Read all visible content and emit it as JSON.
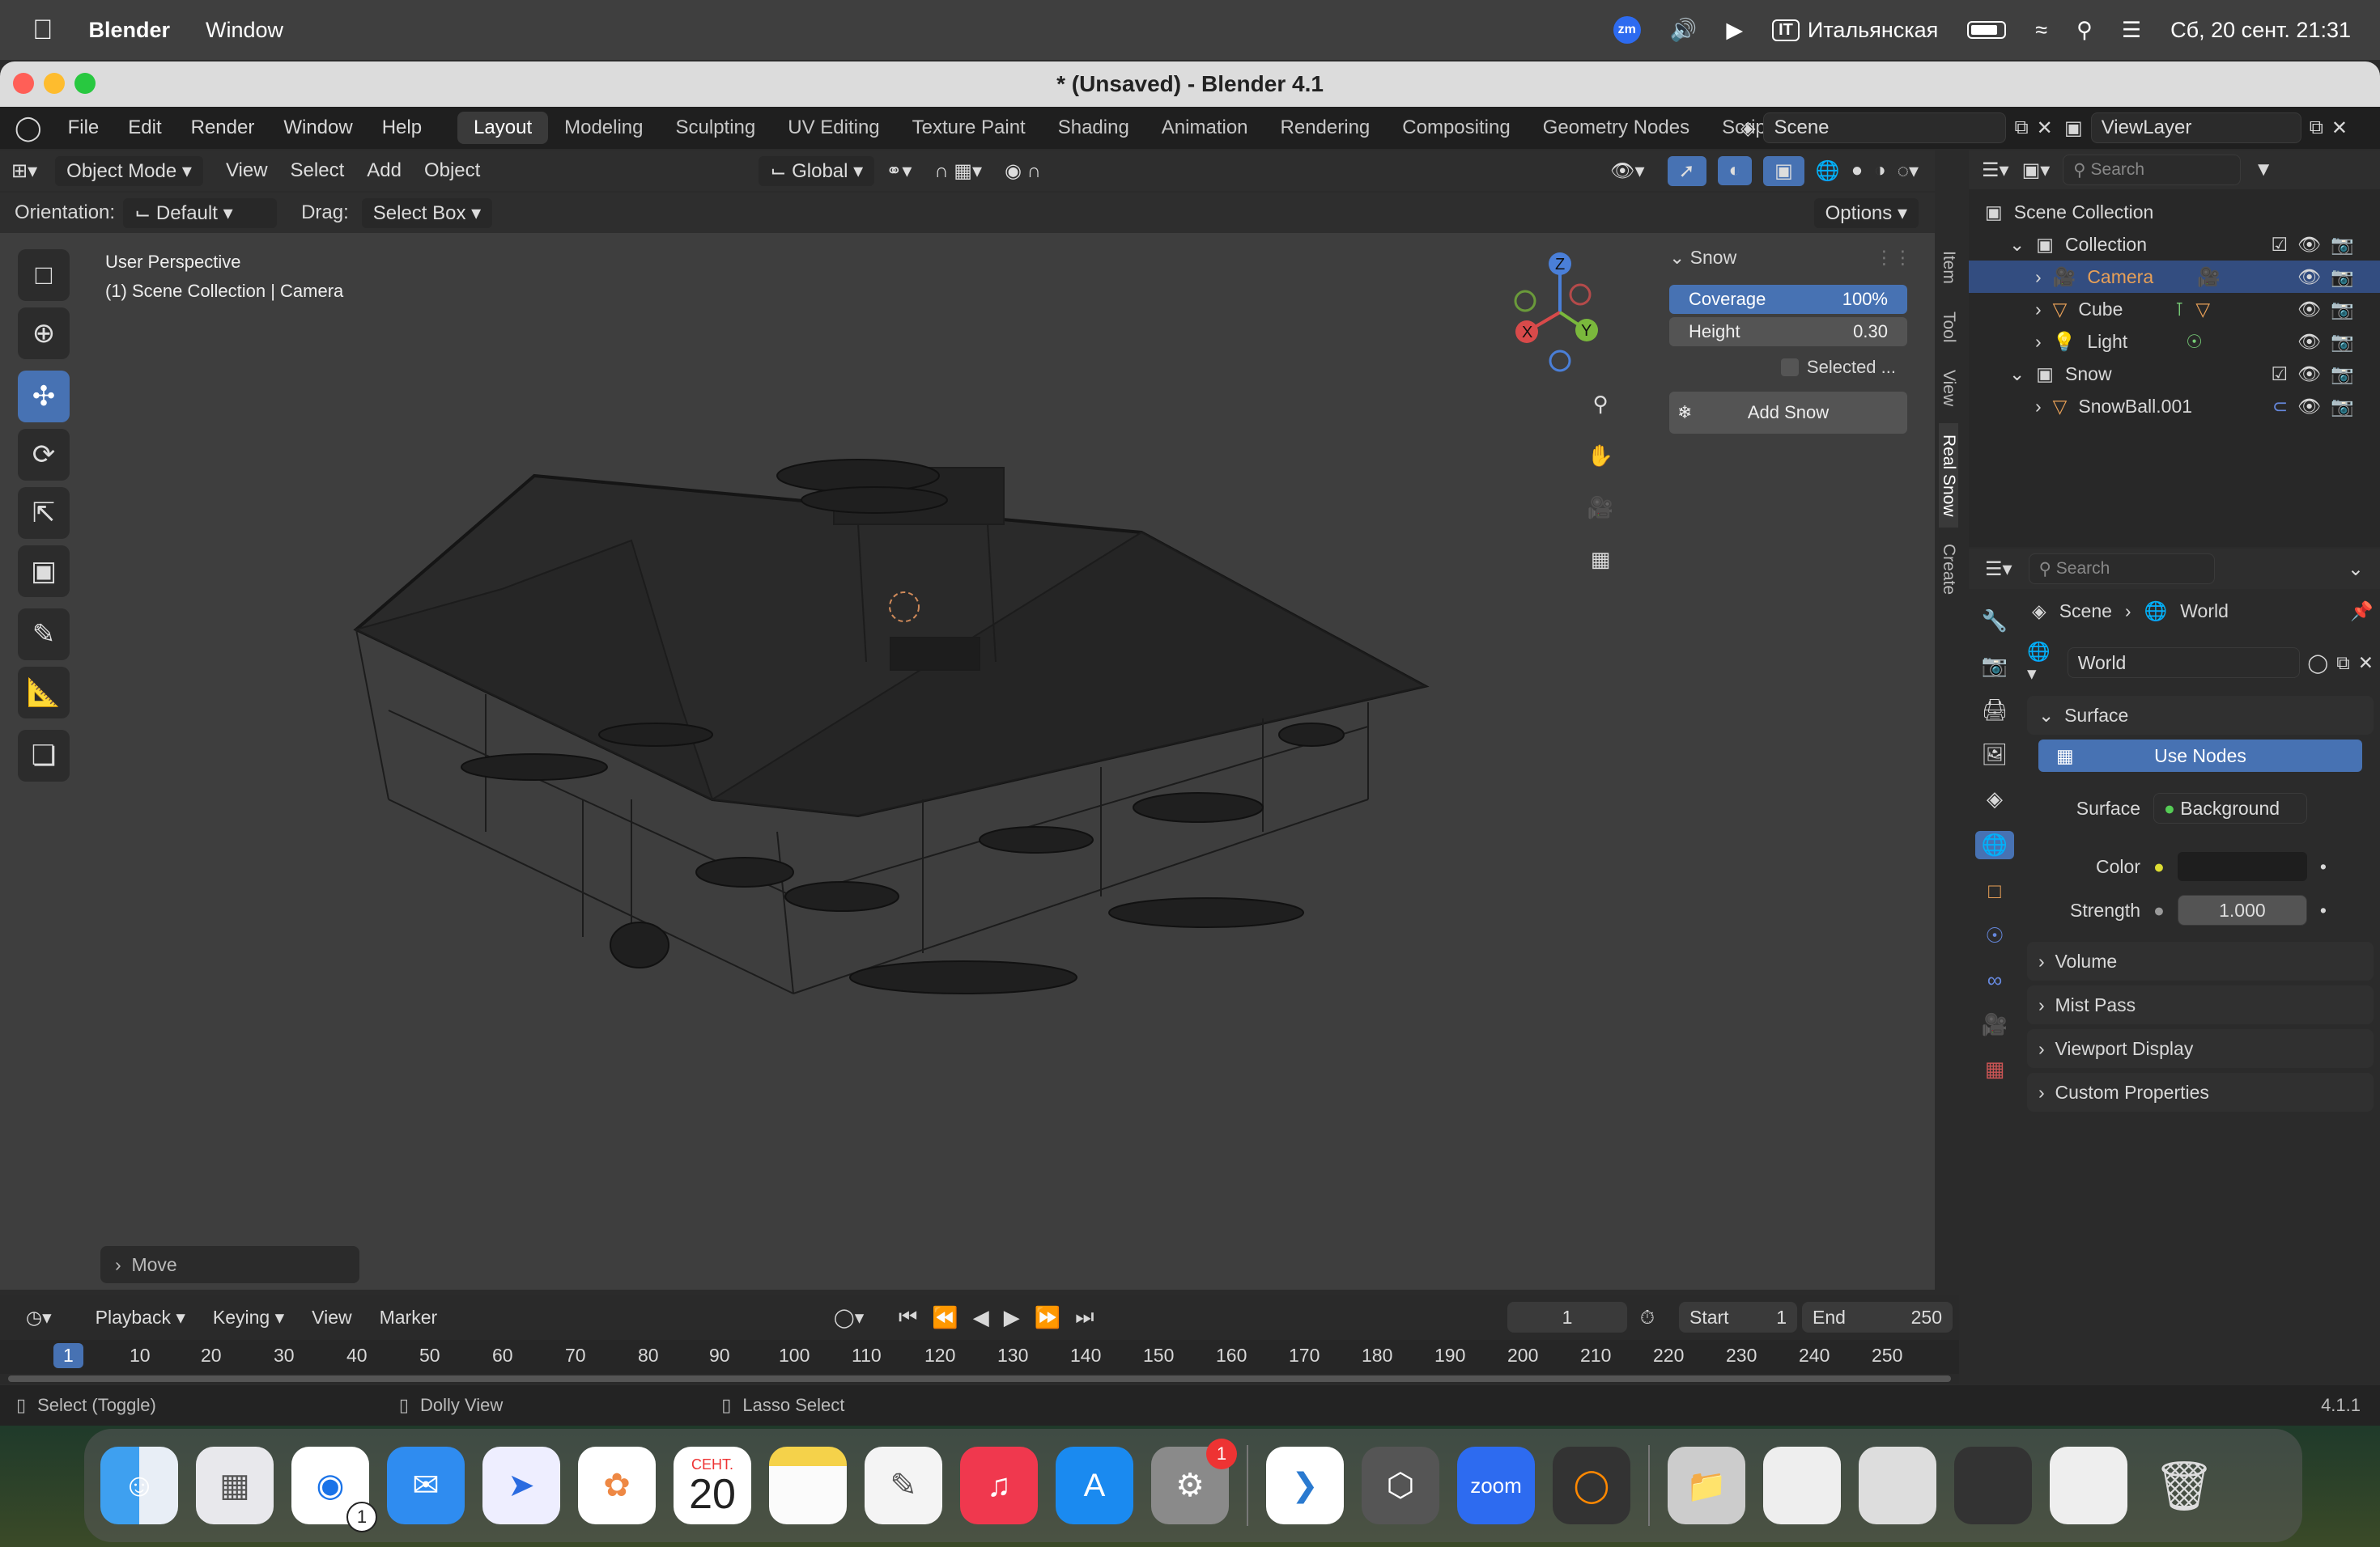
{
  "menubar": {
    "app": "Blender",
    "window": "Window",
    "zoom_badge": "zm",
    "input_lang_code": "IT",
    "input_lang": "Итальянская",
    "datetime": "Сб, 20 сент.  21:31"
  },
  "window": {
    "title": "* (Unsaved) - Blender 4.1"
  },
  "topbar": {
    "menus": [
      "File",
      "Edit",
      "Render",
      "Window",
      "Help"
    ],
    "workspaces": [
      "Layout",
      "Modeling",
      "Sculpting",
      "UV Editing",
      "Texture Paint",
      "Shading",
      "Animation",
      "Rendering",
      "Compositing",
      "Geometry Nodes",
      "Scriptin"
    ],
    "scene": "Scene",
    "view_layer": "ViewLayer"
  },
  "viewport_header": {
    "mode": "Object Mode",
    "menus": [
      "View",
      "Select",
      "Add",
      "Object"
    ],
    "transform": "Global",
    "orientation_label": "Orientation:",
    "orientation_value": "Default",
    "drag_label": "Drag:",
    "drag_value": "Select Box",
    "options": "Options"
  },
  "viewport": {
    "perspective": "User Perspective",
    "context": "(1) Scene Collection | Camera",
    "last_op": "Move"
  },
  "snow_panel": {
    "title": "Snow",
    "coverage_label": "Coverage",
    "coverage_value": "100%",
    "height_label": "Height",
    "height_value": "0.30",
    "selected_label": "Selected ...",
    "add_button": "Add Snow"
  },
  "side_tabs": [
    "Item",
    "Tool",
    "View",
    "Real Snow",
    "Create"
  ],
  "outliner": {
    "search_placeholder": "Search",
    "root": "Scene Collection",
    "rows": [
      {
        "name": "Collection",
        "indent": 1
      },
      {
        "name": "Camera",
        "indent": 2,
        "selected": true
      },
      {
        "name": "Cube",
        "indent": 2
      },
      {
        "name": "Light",
        "indent": 2
      },
      {
        "name": "Snow",
        "indent": 1
      },
      {
        "name": "SnowBall.001",
        "indent": 2
      }
    ]
  },
  "properties": {
    "search_placeholder": "Search",
    "breadcrumb_scene": "Scene",
    "breadcrumb_world": "World",
    "world_name": "World",
    "surface_section": "Surface",
    "use_nodes": "Use Nodes",
    "surface_label": "Surface",
    "surface_value": "Background",
    "color_label": "Color",
    "strength_label": "Strength",
    "strength_value": "1.000",
    "sections": [
      "Volume",
      "Mist Pass",
      "Viewport Display",
      "Custom Properties"
    ]
  },
  "timeline": {
    "menus": [
      "Playback",
      "Keying",
      "View",
      "Marker"
    ],
    "current_frame": "1",
    "start_label": "Start",
    "start_value": "1",
    "end_label": "End",
    "end_value": "250",
    "ruler": [
      "1",
      "10",
      "20",
      "30",
      "40",
      "50",
      "60",
      "70",
      "80",
      "90",
      "100",
      "110",
      "120",
      "130",
      "140",
      "150",
      "160",
      "170",
      "180",
      "190",
      "200",
      "210",
      "220",
      "230",
      "240",
      "250"
    ]
  },
  "statusbar": {
    "hint1": "Select (Toggle)",
    "hint2": "Dolly View",
    "hint3": "Lasso Select",
    "version": "4.1.1"
  },
  "dock": {
    "calendar_month": "СЕНТ.",
    "calendar_day": "20",
    "chrome_badge": "1",
    "settings_badge": "1",
    "zoom_label": "zoom"
  },
  "colors": {
    "accent": "#4772b3",
    "selection": "#334d80",
    "camera": "#e8a057",
    "mesh": "#e8a057"
  }
}
